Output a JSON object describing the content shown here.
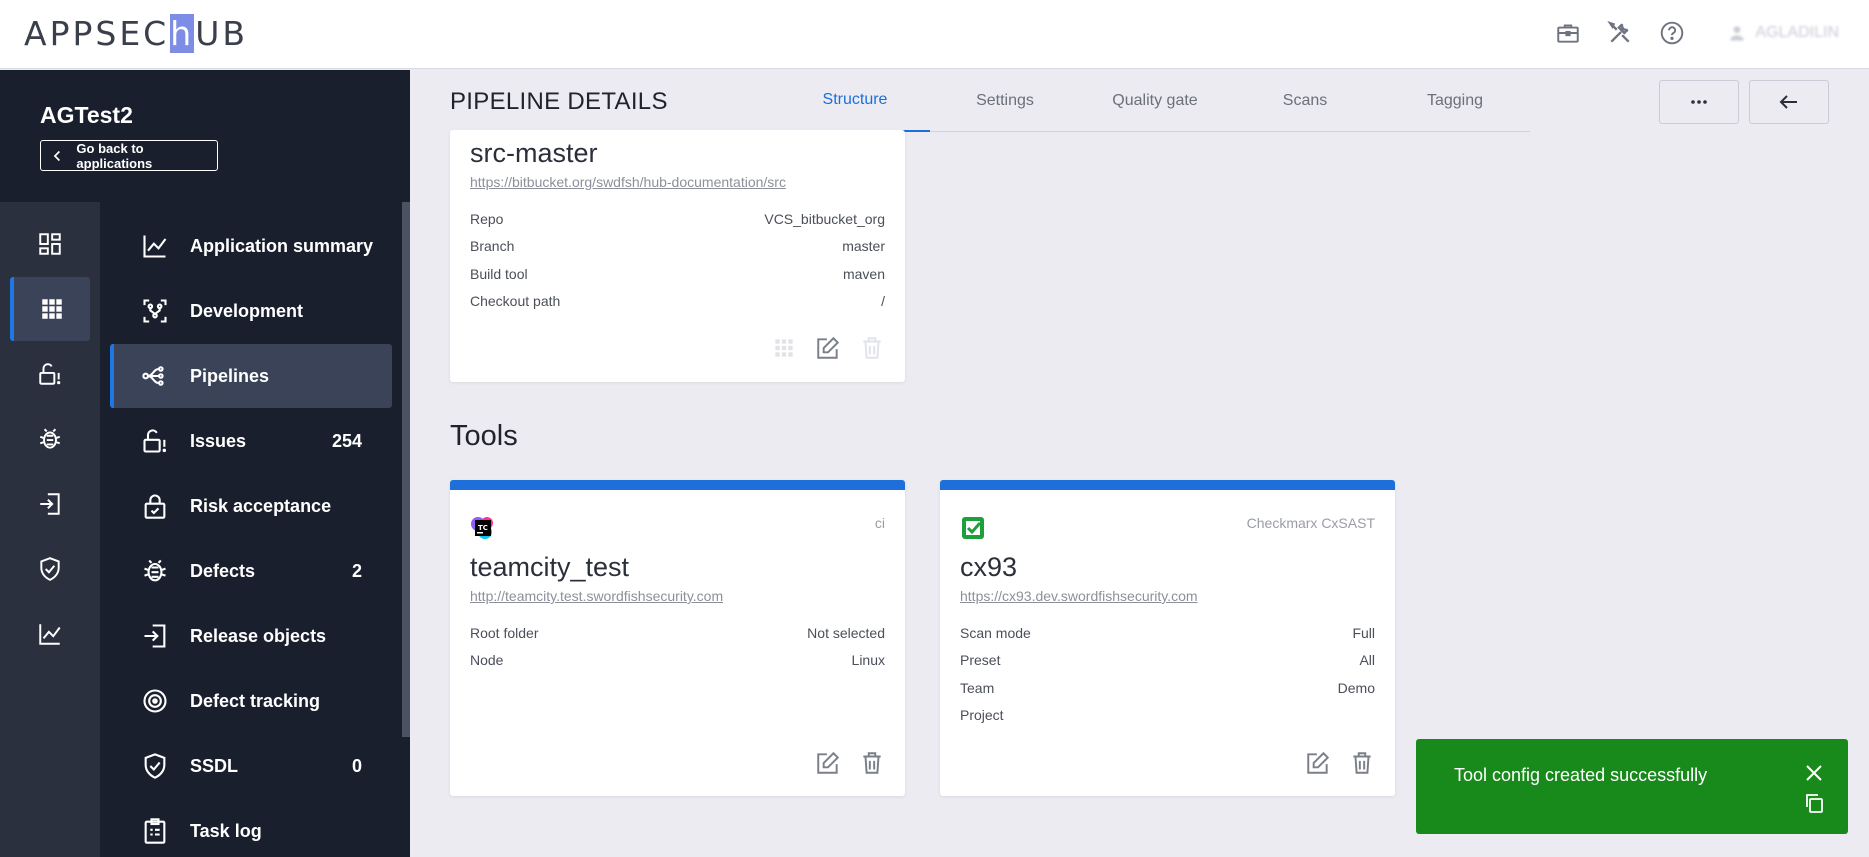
{
  "header": {
    "logo_text_1": "APPSEC",
    "logo_h": "h",
    "logo_text_2": "UB",
    "user_name": "AGLADILIN"
  },
  "sidebar": {
    "app_name": "AGTest2",
    "back_label": "Go back to applications",
    "nav": [
      {
        "label": "Application summary",
        "count": ""
      },
      {
        "label": "Development",
        "count": ""
      },
      {
        "label": "Pipelines",
        "count": ""
      },
      {
        "label": "Issues",
        "count": "254"
      },
      {
        "label": "Risk acceptance",
        "count": ""
      },
      {
        "label": "Defects",
        "count": "2"
      },
      {
        "label": "Release objects",
        "count": ""
      },
      {
        "label": "Defect tracking",
        "count": ""
      },
      {
        "label": "SSDL",
        "count": "0"
      },
      {
        "label": "Task log",
        "count": ""
      }
    ]
  },
  "page": {
    "title": "PIPELINE DETAILS",
    "tabs": [
      "Structure",
      "Settings",
      "Quality gate",
      "Scans",
      "Tagging"
    ],
    "active_tab": "Structure"
  },
  "source_card": {
    "title": "src-master",
    "url": "https://bitbucket.org/swdfsh/hub-documentation/src",
    "fields": [
      {
        "key": "Repo",
        "value": "VCS_bitbucket_org"
      },
      {
        "key": "Branch",
        "value": "master"
      },
      {
        "key": "Build tool",
        "value": "maven"
      },
      {
        "key": "Checkout path",
        "value": "/"
      }
    ]
  },
  "tools_section": {
    "title": "Tools",
    "cards": [
      {
        "type": "ci",
        "logo": "teamcity-logo",
        "title": "teamcity_test",
        "url": "http://teamcity.test.swordfishsecurity.com",
        "fields": [
          {
            "key": "Root folder",
            "value": "Not selected"
          },
          {
            "key": "Node",
            "value": "Linux"
          }
        ]
      },
      {
        "type": "Checkmarx CxSAST",
        "logo": "checkmarx-logo",
        "title": "cx93",
        "url": "https://cx93.dev.swordfishsecurity.com",
        "fields": [
          {
            "key": "Scan mode",
            "value": "Full"
          },
          {
            "key": "Preset",
            "value": "All"
          },
          {
            "key": "Team",
            "value": "Demo"
          },
          {
            "key": "Project",
            "value": ""
          }
        ]
      }
    ]
  },
  "toast": {
    "message": "Tool config created successfully",
    "color": "#188a1b"
  },
  "colors": {
    "accent": "#1e6fd9",
    "sidebar_bg": "#1a1f2e",
    "rail_bg": "#2a303e"
  }
}
